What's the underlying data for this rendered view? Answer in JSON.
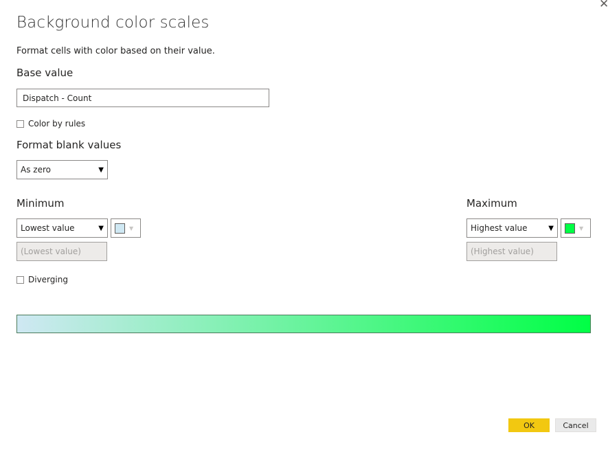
{
  "dialog": {
    "title": "Background color scales",
    "close_glyph": "✕",
    "subtitle": "Format cells with color based on their value."
  },
  "base_value": {
    "label": "Base value",
    "value": "Dispatch - Count"
  },
  "color_by_rules": {
    "label": "Color by rules",
    "checked": false
  },
  "format_blank": {
    "label": "Format blank values",
    "selected": "As zero"
  },
  "minimum": {
    "label": "Minimum",
    "type_selected": "Lowest value",
    "color": "#cfe8f3",
    "value_placeholder": "(Lowest value)"
  },
  "maximum": {
    "label": "Maximum",
    "type_selected": "Highest value",
    "color": "#00ff45",
    "value_placeholder": "(Highest value)"
  },
  "diverging": {
    "label": "Diverging",
    "checked": false
  },
  "gradient": {
    "from": "#cfe8f3",
    "to": "#00ff45"
  },
  "buttons": {
    "ok": "OK",
    "cancel": "Cancel"
  },
  "icons": {
    "dropdown": "caret-down-icon",
    "close": "close-icon"
  }
}
